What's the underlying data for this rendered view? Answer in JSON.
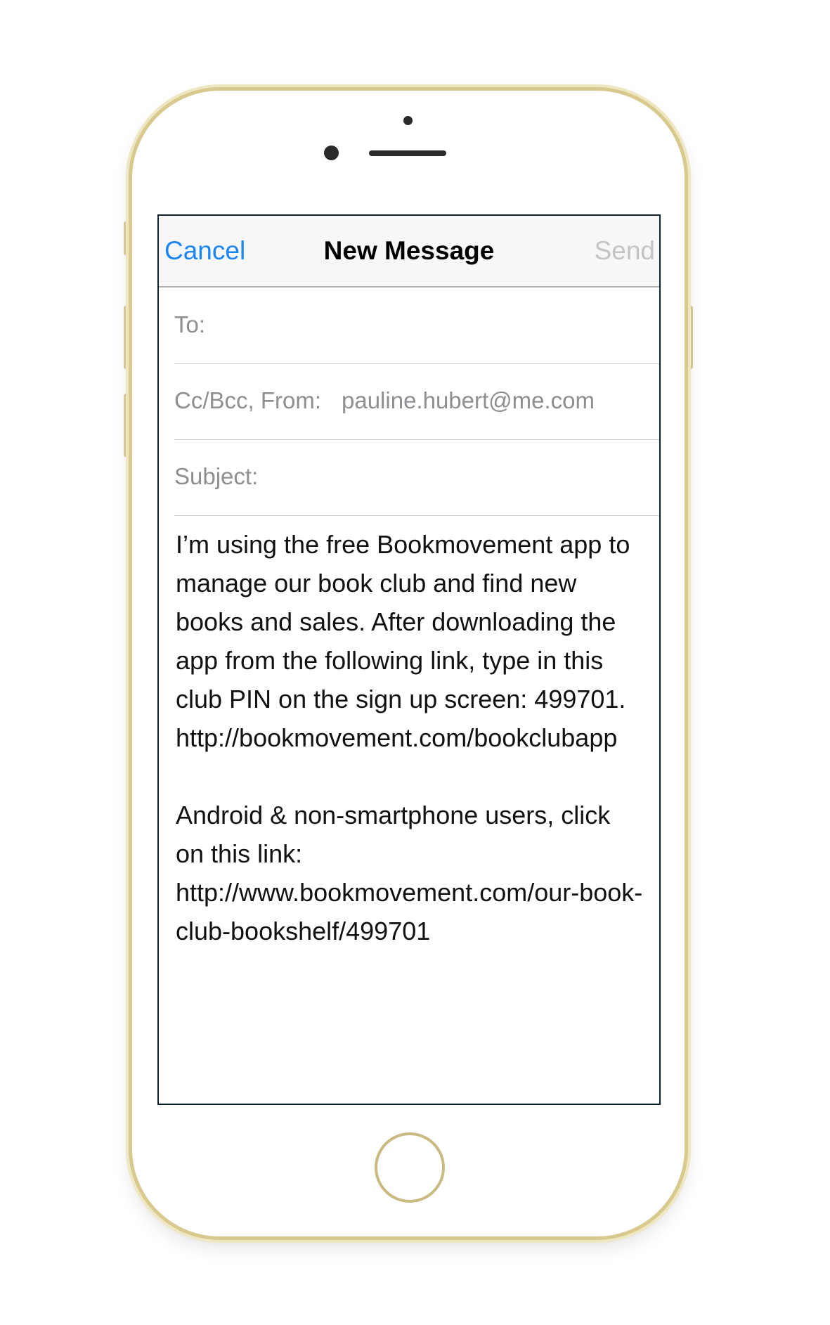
{
  "navbar": {
    "cancel_label": "Cancel",
    "title": "New Message",
    "send_label": "Send"
  },
  "fields": {
    "to_label": "To:",
    "cc_label": "Cc/Bcc, From:",
    "from_value": "pauline.hubert@me.com",
    "subject_label": "Subject:"
  },
  "body": {
    "paragraph1": "I’m using the free Bookmovement app to manage our book club and find new books and sales. After downloading the app from the following link, type in this club PIN on the sign up screen: 499701. http://bookmovement.com/bookclubapp",
    "paragraph2": "Android & non-smartphone users, click on this link: http://www.bookmovement.com/our-book-club-bookshelf/499701"
  },
  "colors": {
    "accent": "#1a85f5",
    "disabled": "#c4c4c4",
    "phone_frame": "#d8c98f"
  }
}
